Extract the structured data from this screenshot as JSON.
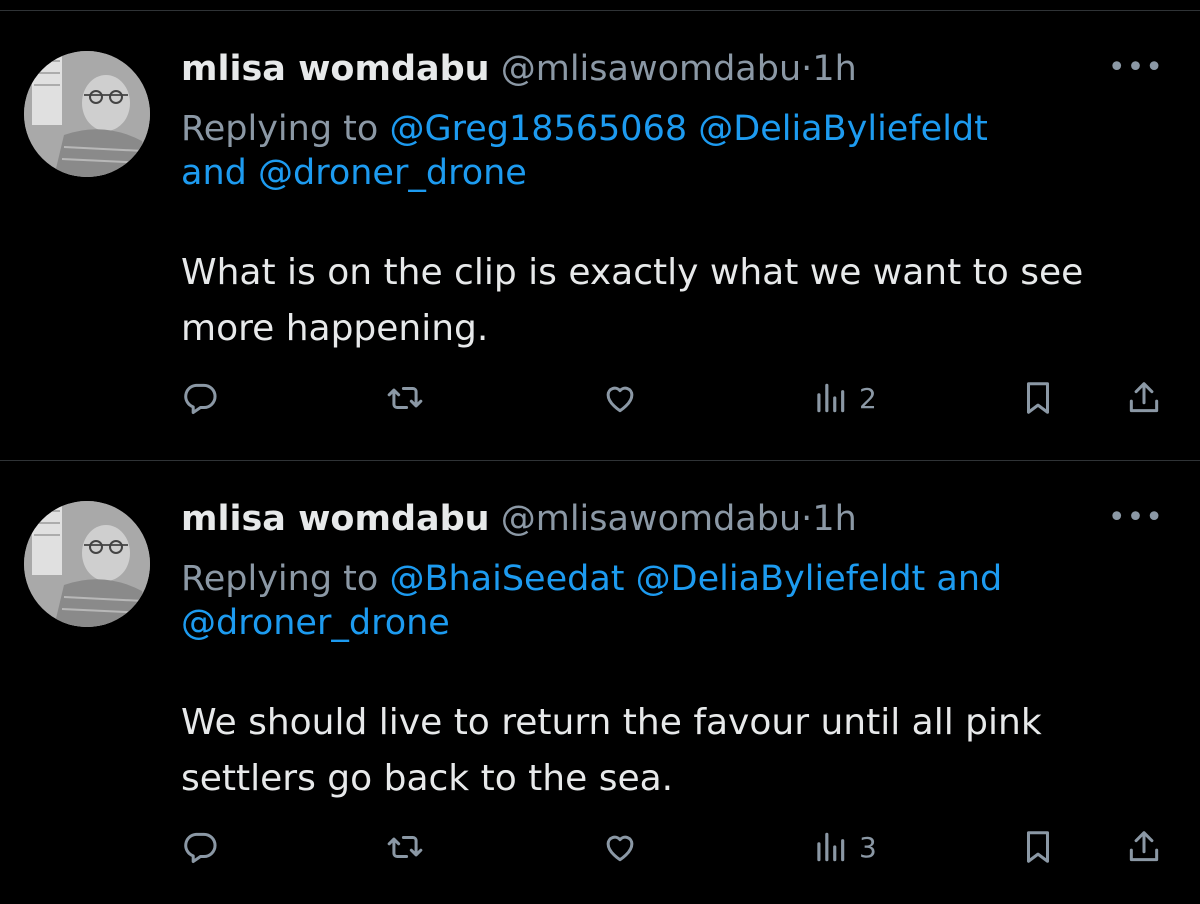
{
  "tweets": [
    {
      "display_name": "mlisa womdabu",
      "handle": "@mlisawomdabu",
      "separator": "·",
      "time": "1h",
      "more_label": "•••",
      "replying_prefix": "Replying to",
      "mention_1": "@Greg18565068",
      "mention_2": "@DeliaByliefeldt",
      "and_text": "and",
      "mention_3": "@droner_drone",
      "text": "What is on the clip is exactly what we want to see more happening.",
      "views_count": "2"
    },
    {
      "display_name": "mlisa womdabu",
      "handle": "@mlisawomdabu",
      "separator": "·",
      "time": "1h",
      "more_label": "•••",
      "replying_prefix": "Replying to",
      "mention_1": "@BhaiSeedat",
      "mention_2": "@DeliaByliefeldt",
      "and_text": "and",
      "mention_3": "@droner_drone",
      "text": "We should live to return the favour until all pink settlers go back to the sea.",
      "views_count": "3"
    }
  ],
  "icons": {
    "reply": "reply-icon",
    "retweet": "retweet-icon",
    "like": "heart-icon",
    "views": "views-icon",
    "bookmark": "bookmark-icon",
    "share": "share-icon"
  },
  "colors": {
    "background": "#000000",
    "text": "#e7e9ea",
    "muted": "#8b98a5",
    "link": "#1d9bf0",
    "divider": "#2f3336"
  }
}
